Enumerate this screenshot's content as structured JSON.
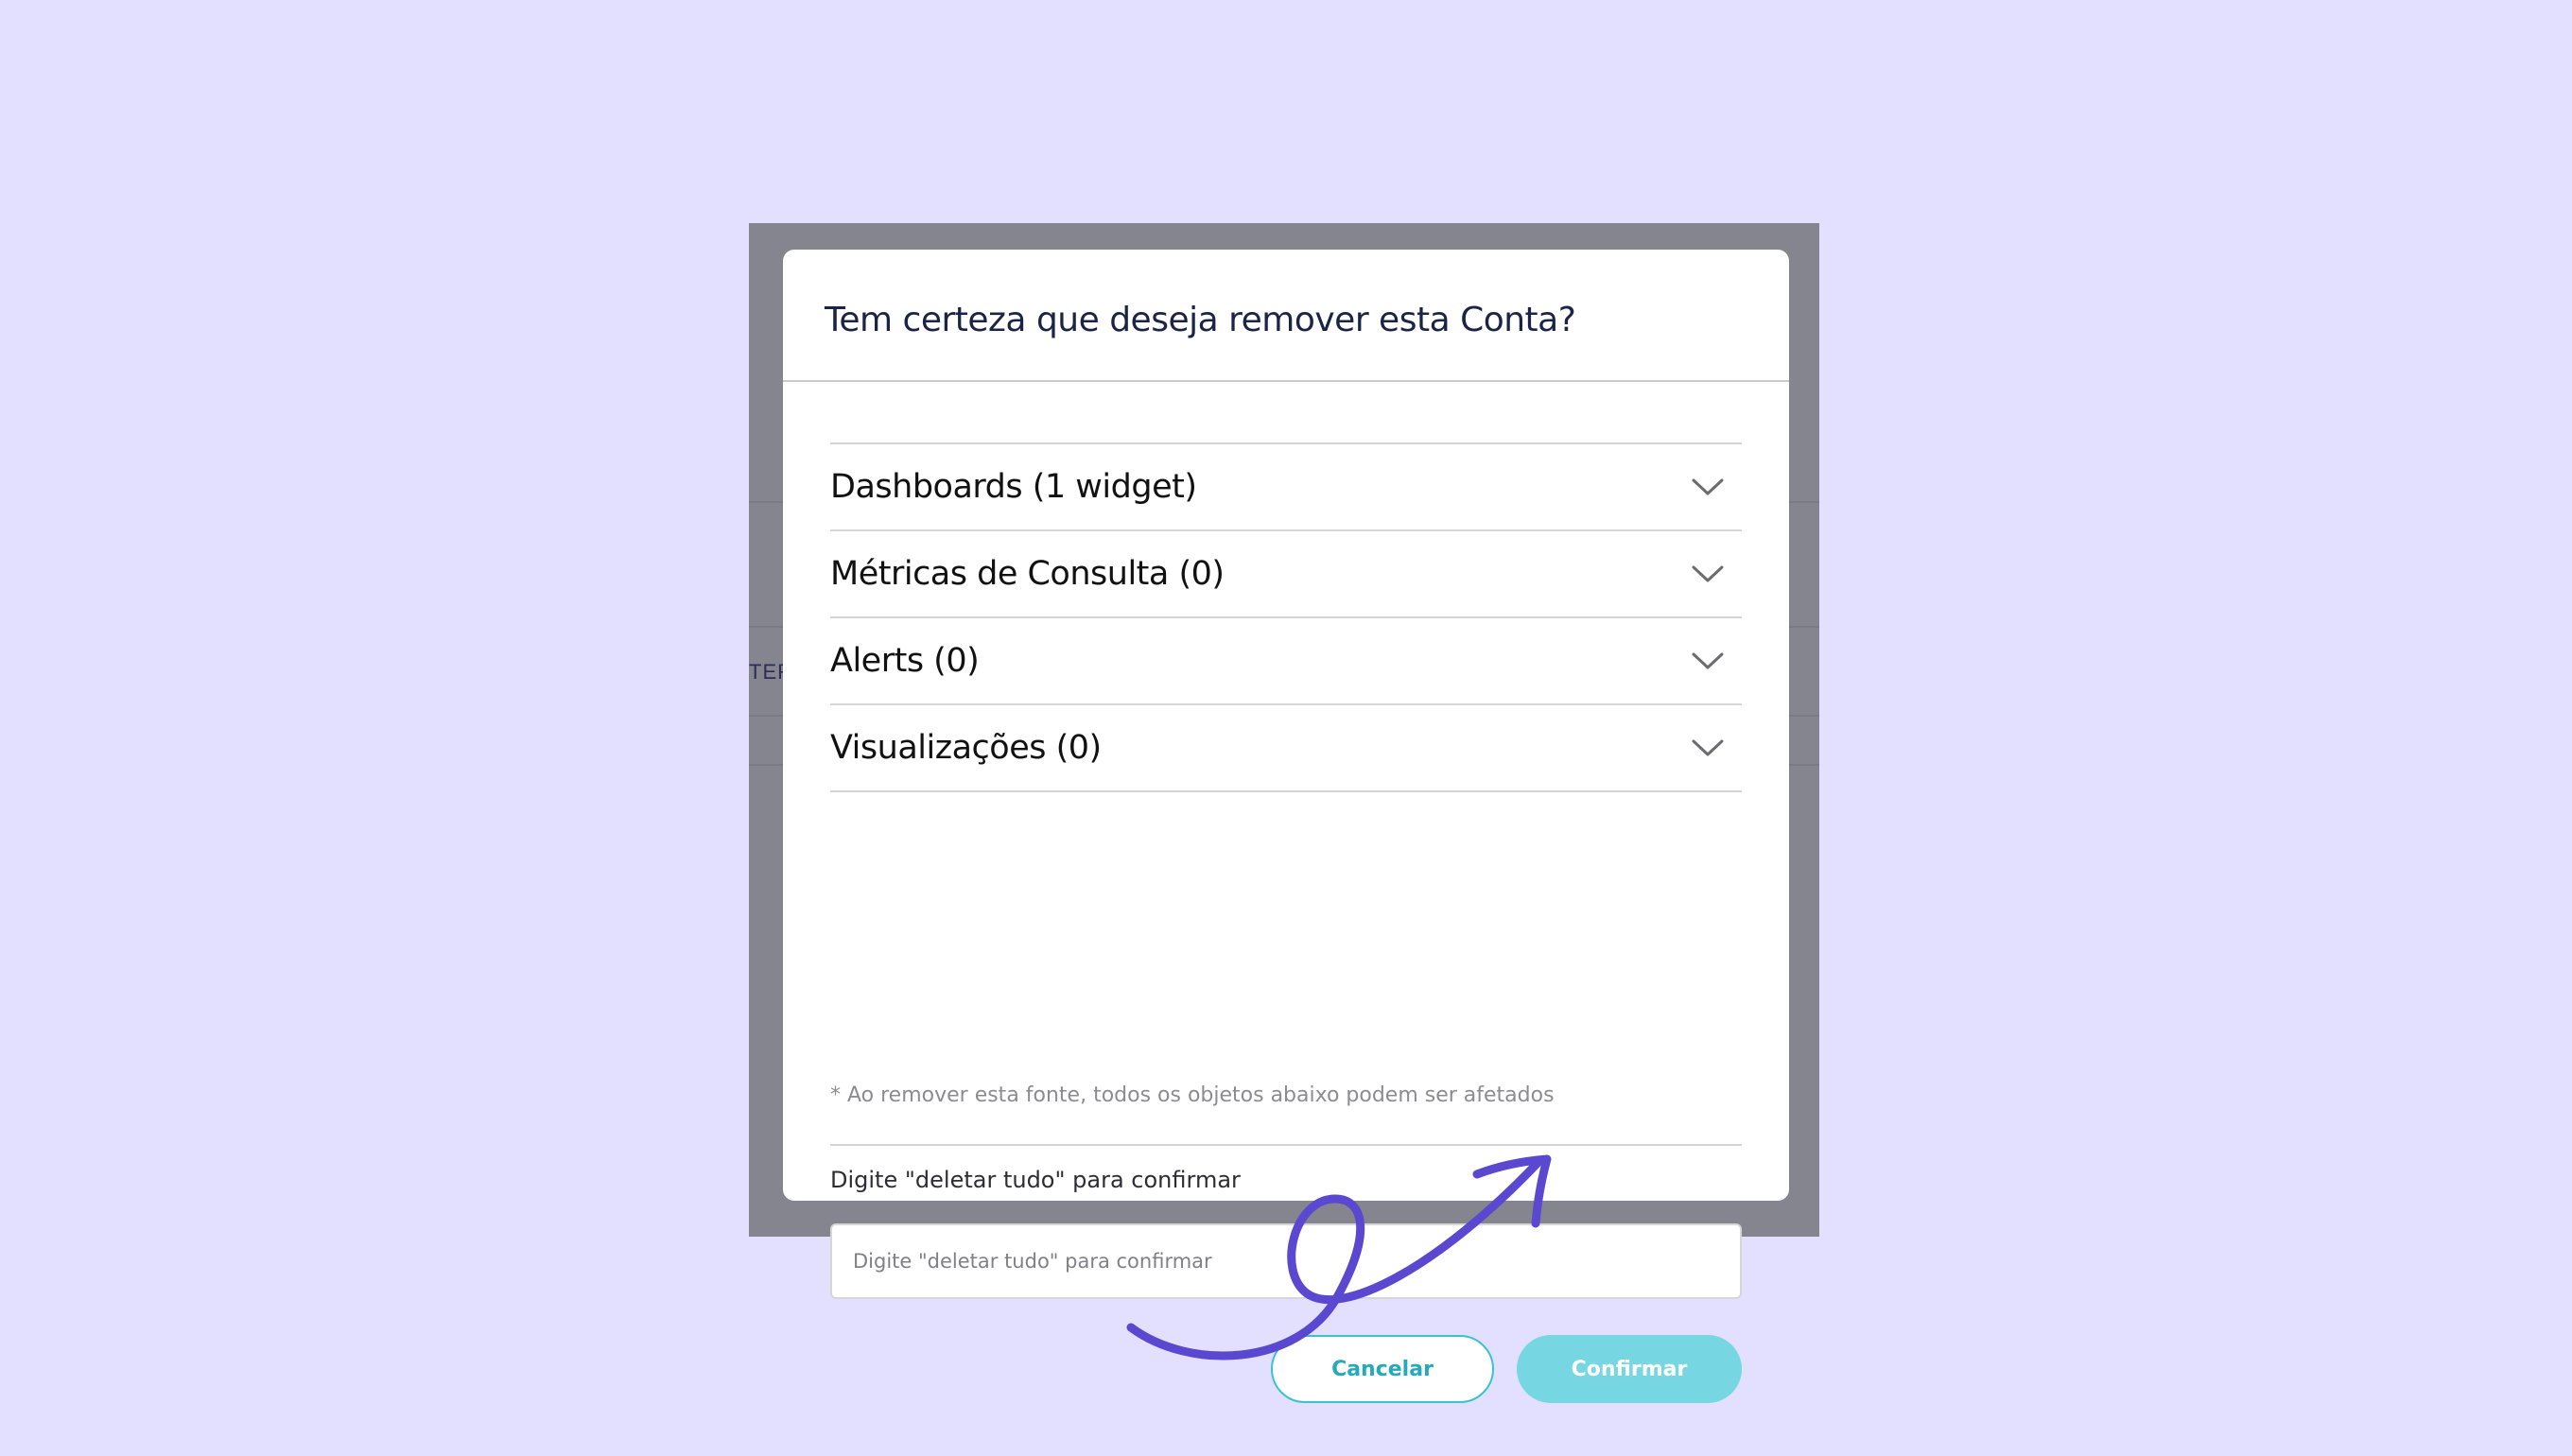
{
  "background": {
    "partial_text": "TER"
  },
  "modal": {
    "title": "Tem certeza que deseja remover esta Conta?",
    "sections": [
      {
        "label": "Dashboards (1 widget)"
      },
      {
        "label": "Métricas de Consulta (0)"
      },
      {
        "label": "Alerts (0)"
      },
      {
        "label": "Visualizações (0)"
      }
    ],
    "note": "* Ao remover esta fonte, todos os objetos abaixo podem ser afetados",
    "confirm_field": {
      "label": "Digite \"deletar tudo\" para confirmar",
      "placeholder": "Digite \"deletar tudo\" para confirmar",
      "value": ""
    },
    "cancel_label": "Cancelar",
    "confirm_label": "Confirmar"
  },
  "colors": {
    "page_background": "#e3dfff",
    "accent": "#38c3d0",
    "confirm_button": "#76d6e2",
    "annotation_arrow": "#5a48d0"
  },
  "icons": {
    "section_toggle": "chevron-down-icon",
    "annotation": "hand-drawn-arrow"
  }
}
